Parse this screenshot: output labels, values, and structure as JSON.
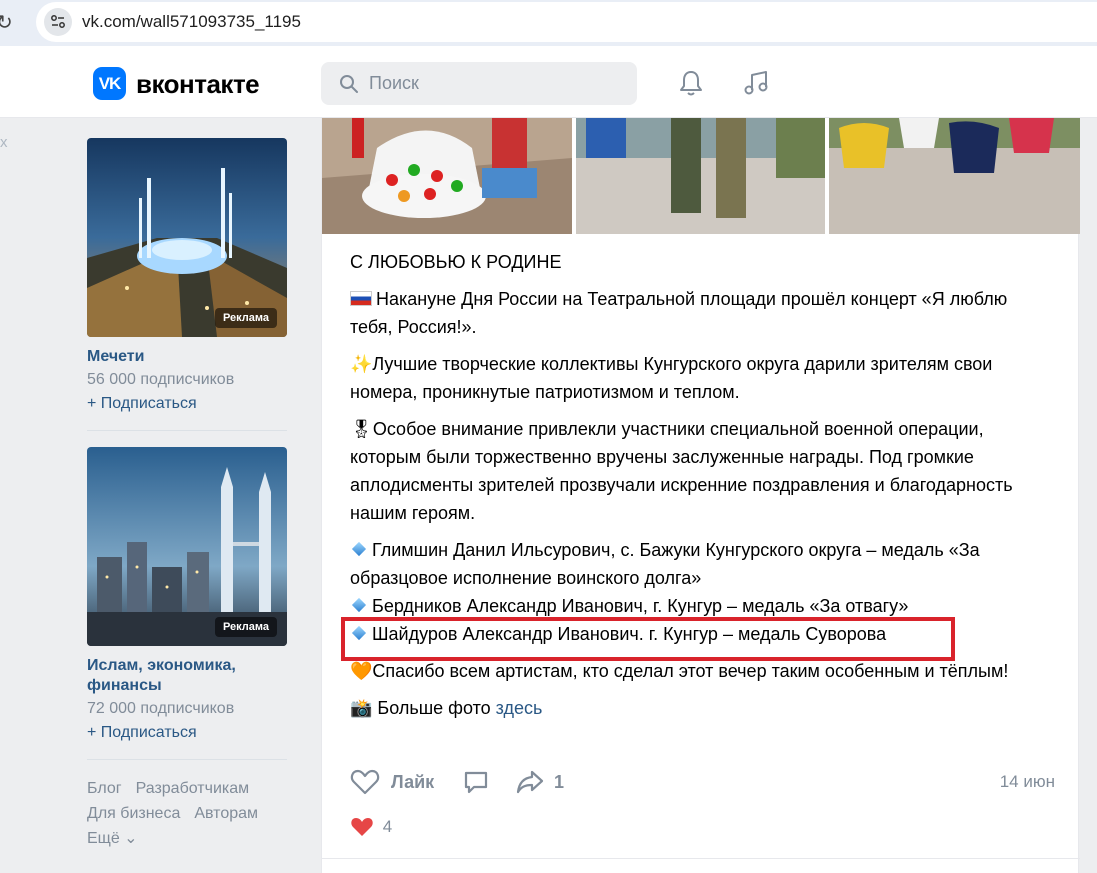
{
  "browser": {
    "url": "vk.com/wall571093735_1195"
  },
  "header": {
    "logo_text": "VK",
    "wordmark": "вконтакте",
    "search_placeholder": "Поиск"
  },
  "left_strip": {
    "text": "х"
  },
  "ads": [
    {
      "title": "Мечети",
      "subscribers": "56 000 подписчиков",
      "subscribe": "+ Подписаться",
      "badge": "Реклама"
    },
    {
      "title": "Ислам, экономика, финансы",
      "subscribers": "72 000 подписчиков",
      "subscribe": "+ Подписаться",
      "badge": "Реклама"
    }
  ],
  "footer": {
    "links": [
      "Блог",
      "Разработчикам",
      "Для бизнеса",
      "Авторам",
      "Ещё ⌄"
    ]
  },
  "post": {
    "heading": "С ЛЮБОВЬЮ К РОДИНЕ",
    "para1": "Накануне Дня России на Театральной площади прошёл концерт «Я люблю тебя, Россия!».",
    "para2": "✨Лучшие творческие коллективы Кунгурского округа дарили зрителям свои номера, проникнутые патриотизмом и теплом.",
    "para3": "🎖Особое внимание привлекли участники специальной военной операции, которым были торжественно вручены заслуженные награды. Под громкие аплодисменты зрителей прозвучали искренние поздравления и благодарность нашим героям.",
    "award1": "Глимшин Данил Ильсурович, с. Бажуки Кунгурского округа – медаль «За образцовое исполнение воинского долга»",
    "award2": "Бердников Александр Иванович, г. Кунгур – медаль «За отвагу»",
    "award3": "Шайдуров Александр Иванович. г. Кунгур – медаль Суворова",
    "thanks": "🧡Спасибо всем артистам, кто сделал этот вечер таким особенным и тёплым!",
    "more_photos_prefix": "📸 Больше фото",
    "more_photos_link": "здесь",
    "like_label": "Лайк",
    "share_count": "1",
    "date": "14 июн",
    "reactions_count": "4"
  },
  "colors": {
    "vk_blue": "#0077ff",
    "link": "#2a5885",
    "highlight": "#d9232b"
  }
}
